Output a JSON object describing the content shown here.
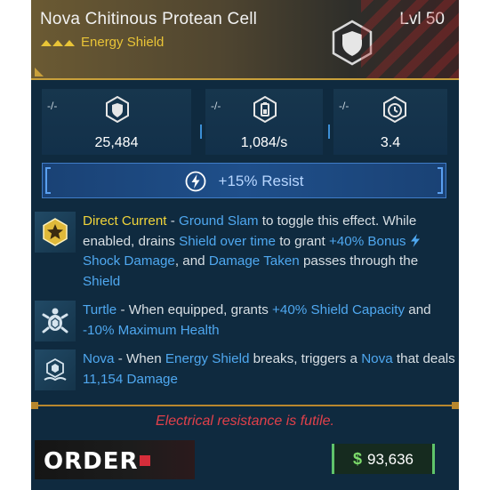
{
  "item": {
    "name": "Nova Chitinous Protean Cell",
    "level": "Lvl 50",
    "type": "Energy Shield",
    "rarity_icon": "triple-chevron-icon",
    "badge_icon": "shield-badge-icon"
  },
  "stats": [
    {
      "compare": "-/-",
      "icon": "shield-capacity-icon",
      "value": "25,484"
    },
    {
      "compare": "-/-",
      "icon": "recharge-rate-icon",
      "value": "1,084/s"
    },
    {
      "compare": "-/-",
      "icon": "recharge-delay-icon",
      "value": "3.4"
    }
  ],
  "resist": {
    "icon": "lightning-icon",
    "text": "+15% Resist"
  },
  "perks": [
    {
      "icon": "direct-current-icon",
      "name": "Direct Current",
      "parts": {
        "dash": " - ",
        "ground_slam": "Ground Slam",
        "t1": " to toggle this effect. While enabled, drains ",
        "shield_over_time": "Shield over time",
        "t2": " to grant ",
        "bonus": "+40% Bonus ",
        "shock_damage": "Shock Damage",
        "t3": ", and ",
        "damage_taken": "Damage Taken",
        "t4": " passes through the ",
        "shield": "Shield"
      }
    },
    {
      "icon": "turtle-icon",
      "name": "Turtle",
      "parts": {
        "t1": " - When equipped, grants ",
        "shield_capacity": "+40% Shield Capacity",
        "t2": " and ",
        "max_health": "-10% Maximum Health"
      }
    },
    {
      "icon": "nova-icon",
      "name": "Nova",
      "parts": {
        "t1": " - When ",
        "energy_shield": "Energy Shield",
        "t2": " breaks, triggers a ",
        "nova": "Nova",
        "t3": " that deals ",
        "damage": "11,154 Damage"
      }
    }
  ],
  "flavor_text": "Electrical resistance is futile.",
  "manufacturer": {
    "name": "ORDER"
  },
  "price": {
    "currency": "$",
    "value": "93,636"
  },
  "colors": {
    "accent_yellow": "#f0d43a",
    "accent_blue": "#4fa8f0",
    "flavor_red": "#e0404a",
    "price_green": "#5fc46b"
  }
}
